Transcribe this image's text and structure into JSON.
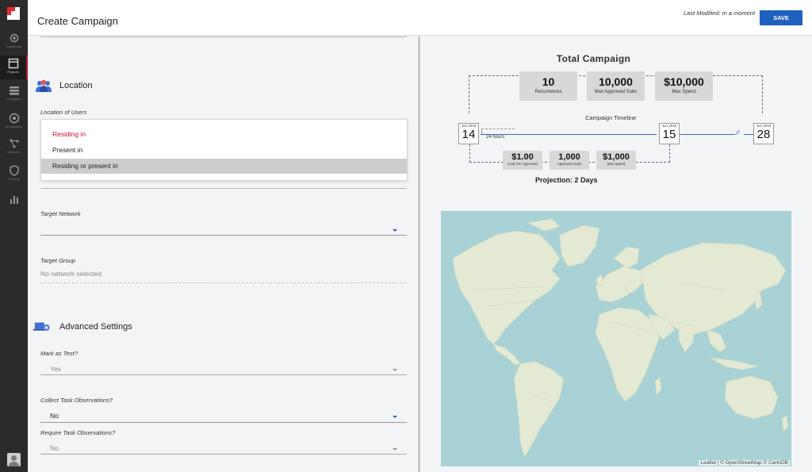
{
  "header": {
    "title": "Create Campaign",
    "last_modified": "Last Modified: in a moment",
    "save_label": "SAVE"
  },
  "sidebar": {
    "items": [
      {
        "label": "Dashboard",
        "icon": "camera-icon"
      },
      {
        "label": "Projects",
        "icon": "projects-icon"
      },
      {
        "label": "Campaigns",
        "icon": "stack-icon"
      },
      {
        "label": "Applications",
        "icon": "target-icon"
      },
      {
        "label": "Networks",
        "icon": "network-icon"
      },
      {
        "label": "Security",
        "icon": "shield-icon"
      },
      {
        "label": "",
        "icon": "bar-chart-icon"
      }
    ]
  },
  "form": {
    "location": {
      "heading": "Location",
      "field_label": "Location of Users",
      "options": [
        "Residing in",
        "Present in",
        "Residing or present in"
      ]
    },
    "target_network": {
      "label": "Target Network",
      "value": ""
    },
    "target_group": {
      "label": "Target Group",
      "value": "No network selected"
    },
    "advanced": {
      "heading": "Advanced Settings",
      "mark_as_test": {
        "label": "Mark as Test?",
        "value": "Yes"
      },
      "collect_obs": {
        "label": "Collect Task Observations?",
        "value": "No"
      },
      "require_obs": {
        "label": "Require Task Observations?",
        "value": "No"
      }
    }
  },
  "summary": {
    "title": "Total Campaign",
    "stats": [
      {
        "value": "10",
        "label": "Recurrences"
      },
      {
        "value": "10,000",
        "label": "Max Approved Subs"
      },
      {
        "value": "$10,000",
        "label": "Max Spend"
      }
    ],
    "timeline_label": "Campaign Timeline",
    "dates": [
      {
        "month": "Jun 2018",
        "day": "14"
      },
      {
        "month": "Jun 2018",
        "day": "15"
      },
      {
        "month": "Jun 2018",
        "day": "28"
      }
    ],
    "interval": "24 hours",
    "per_stats": [
      {
        "value": "$1.00",
        "label": "Cost Per Approved"
      },
      {
        "value": "1,000",
        "label": "Approved Subs"
      },
      {
        "value": "$1,000",
        "label": "Max Spend"
      }
    ],
    "projection": "Projection: 2 Days"
  },
  "map": {
    "attribution": "Leaflet | © OpenStreetMap © CartoDB",
    "ocean_color": "#a8d2d6",
    "land_color": "#e3e9d3"
  },
  "colors": {
    "accent_blue": "#1f5fbf",
    "brand_red": "#c8102e"
  }
}
